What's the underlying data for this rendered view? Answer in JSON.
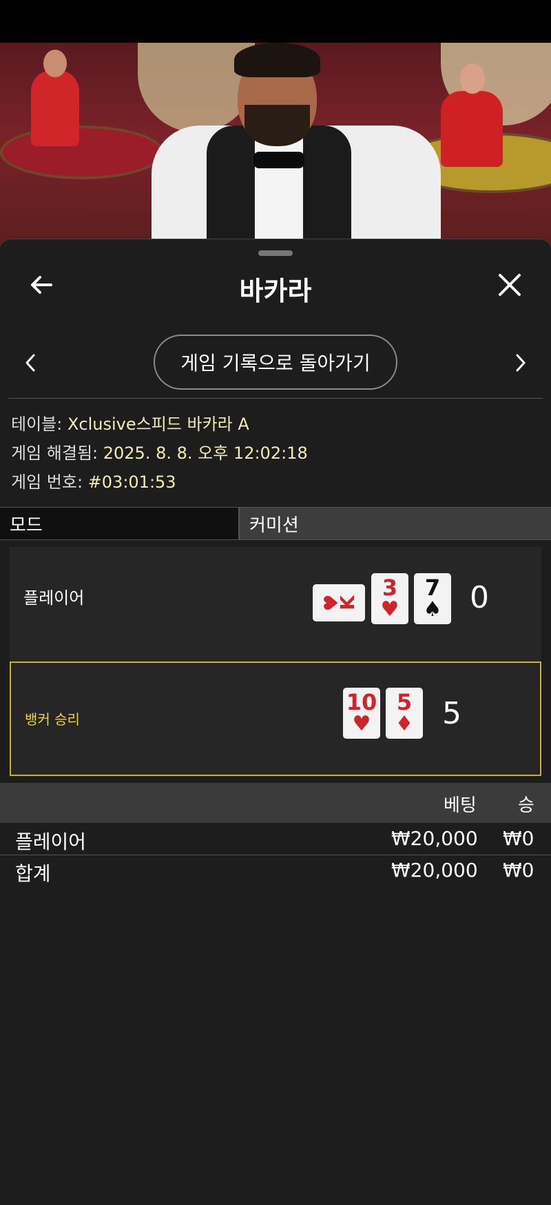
{
  "header": {
    "title": "바카라"
  },
  "nav": {
    "return_label": "게임 기록으로 돌아가기"
  },
  "info": {
    "table_label": "테이블: ",
    "table_value": "Xclusive스피드 바카라 A",
    "resolved_label": "게임 해결됨: ",
    "resolved_value": "2025. 8. 8. 오후 12:02:18",
    "game_no_label": "게임 번호: ",
    "game_no_value": "#03:01:53"
  },
  "tabs": {
    "mode": "모드",
    "commission": "커미션"
  },
  "result": {
    "player": {
      "label": "플레이어",
      "score": "0",
      "cards": [
        {
          "rank": "K",
          "suit": "♥",
          "color": "red",
          "orientation": "sideways"
        },
        {
          "rank": "3",
          "suit": "♥",
          "color": "red"
        },
        {
          "rank": "7",
          "suit": "♠",
          "color": "black"
        }
      ]
    },
    "banker": {
      "label": "뱅커 승리",
      "score": "5",
      "cards": [
        {
          "rank": "10",
          "suit": "♥",
          "color": "red"
        },
        {
          "rank": "5",
          "suit": "♦",
          "color": "red"
        }
      ]
    },
    "winner_highlight_color": "#c8b41e"
  },
  "bets": {
    "headers": {
      "bet": "베팅",
      "win": "승"
    },
    "rows": [
      {
        "name": "플레이어",
        "bet": "₩20,000",
        "win": "₩0"
      },
      {
        "name": "합계",
        "bet": "₩20,000",
        "win": "₩0"
      }
    ]
  }
}
